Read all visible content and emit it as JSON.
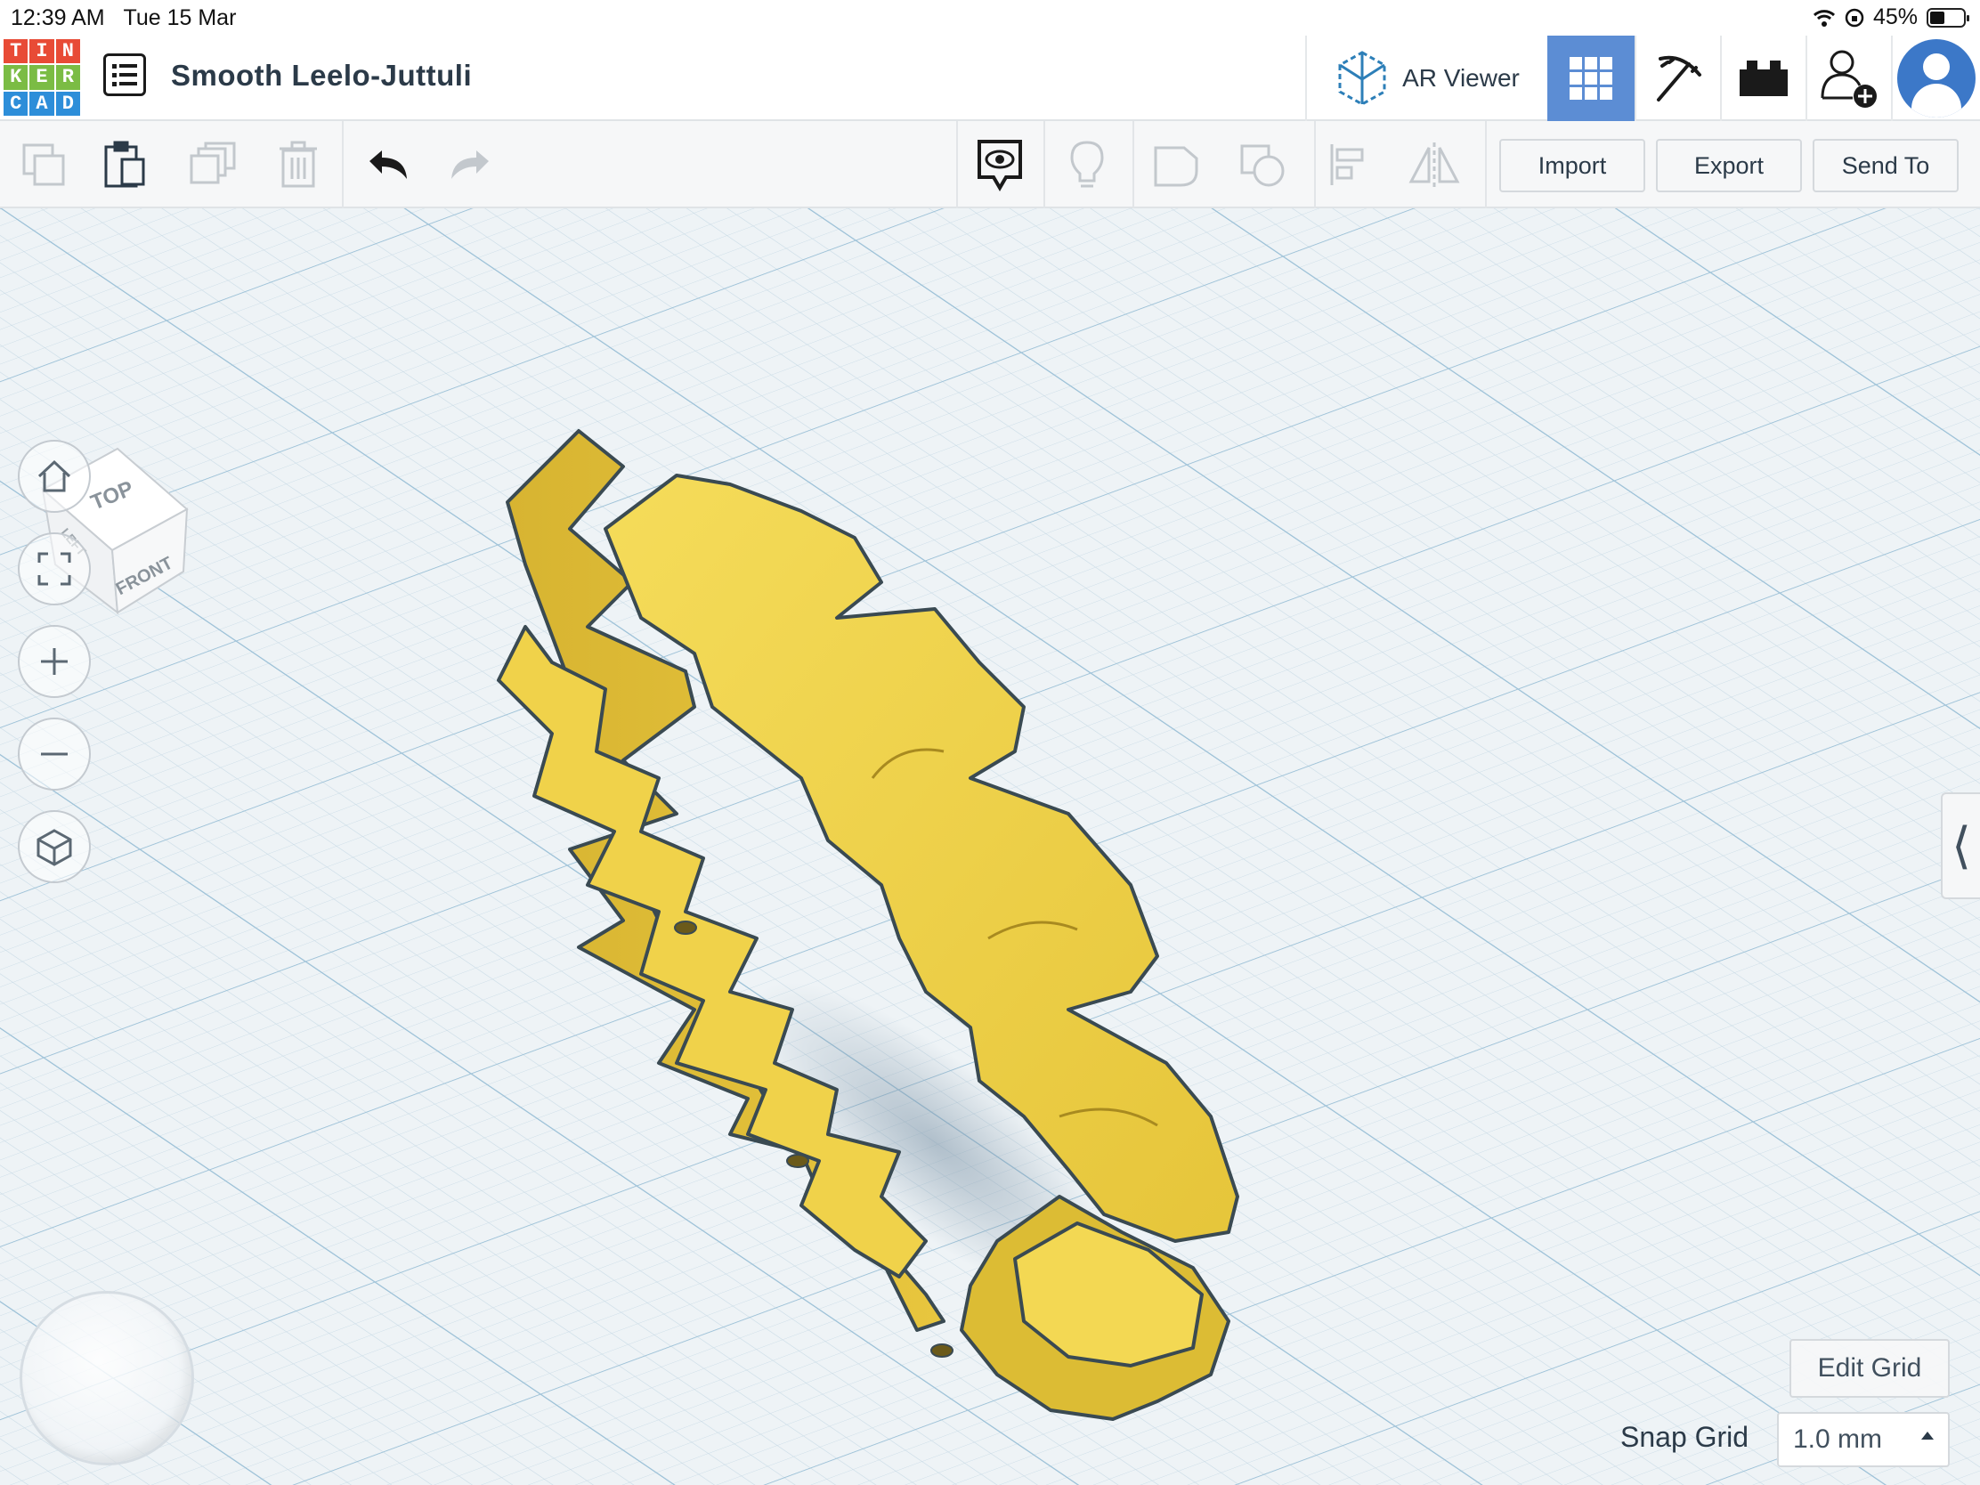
{
  "status_bar": {
    "time": "12:39 AM",
    "date": "Tue 15 Mar",
    "battery": "45%",
    "battery_level": 0.45,
    "icons": [
      "wifi-icon",
      "orientation-lock-icon",
      "battery-icon"
    ]
  },
  "header": {
    "logo_letters": [
      "T",
      "I",
      "N",
      "K",
      "E",
      "R",
      "C",
      "A",
      "D"
    ],
    "logo_colors": [
      "#e84b36",
      "#e84b36",
      "#e84b36",
      "#7bbc44",
      "#7bbc44",
      "#7bbc44",
      "#2d8ed9",
      "#2d8ed9",
      "#2d8ed9"
    ],
    "design_title": "Smooth Leelo-Juttuli",
    "ar_viewer_label": "AR Viewer",
    "icons": [
      "design-list-icon",
      "ar-cube-icon",
      "grid-view-icon",
      "pickaxe-icon",
      "brick-icon",
      "add-user-icon",
      "user-avatar-icon"
    ]
  },
  "toolbar": {
    "icons": [
      "copy-icon",
      "paste-icon",
      "duplicate-icon",
      "delete-icon",
      "undo-icon",
      "redo-icon",
      "notes-visibility-icon",
      "light-bulb-icon",
      "group-icon",
      "ungroup-icon",
      "align-icon",
      "mirror-icon"
    ],
    "import_label": "Import",
    "export_label": "Export",
    "send_to_label": "Send To"
  },
  "view_cube": {
    "top_label": "TOP",
    "front_label": "FRONT",
    "left_label": "LEFT"
  },
  "nav_controls": [
    "home-view-icon",
    "fit-view-icon",
    "zoom-in-icon",
    "zoom-out-icon",
    "perspective-icon"
  ],
  "workplane": {
    "edit_grid_label": "Edit Grid",
    "snap_grid_label": "Snap Grid",
    "snap_grid_value": "1.0 mm",
    "model_color": "#f0d24a",
    "accent_color": "#5c8dd4"
  }
}
